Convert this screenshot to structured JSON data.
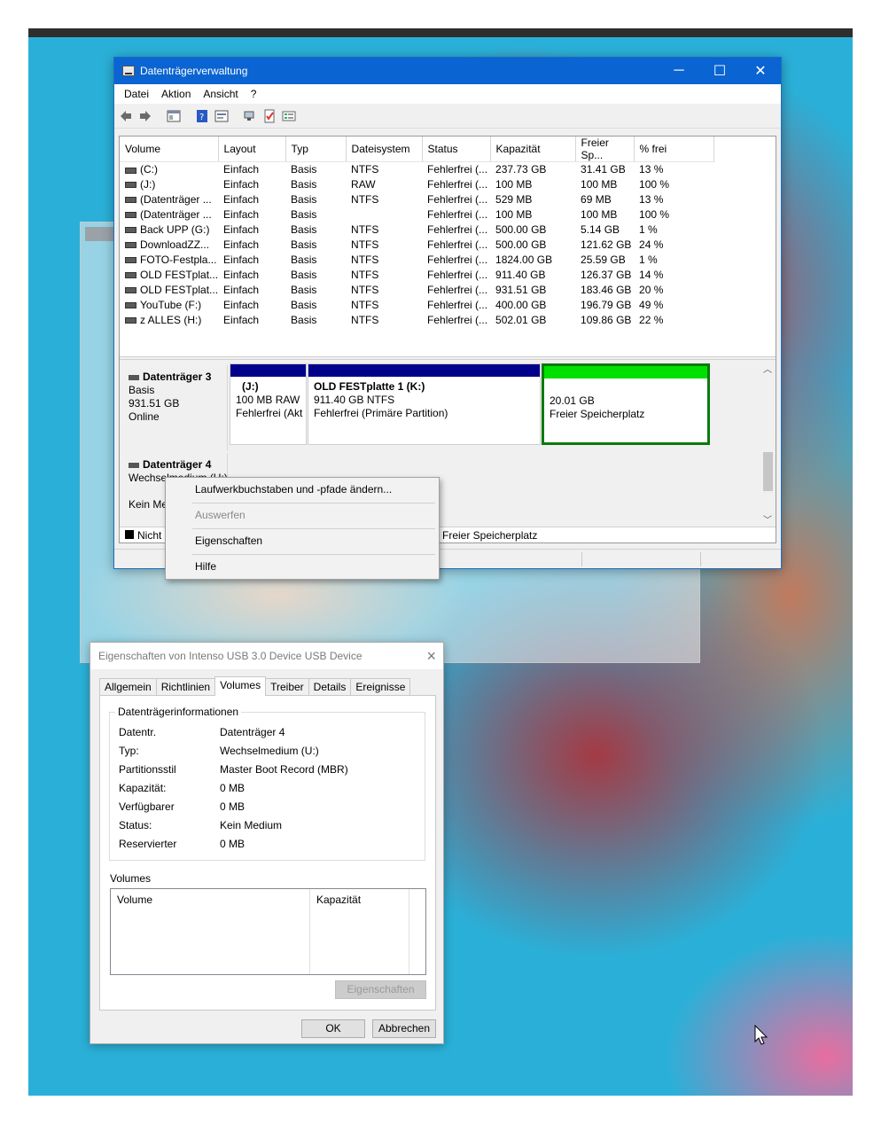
{
  "main_window": {
    "title": "Datenträgerverwaltung",
    "controls": {
      "minimize": "─",
      "maximize": "☐",
      "close": "✕"
    },
    "menu": [
      "Datei",
      "Aktion",
      "Ansicht",
      "?"
    ],
    "columns": [
      "Volume",
      "Layout",
      "Typ",
      "Dateisystem",
      "Status",
      "Kapazität",
      "Freier Sp...",
      "% frei"
    ],
    "volumes": [
      [
        "(C:)",
        "Einfach",
        "Basis",
        "NTFS",
        "Fehlerfrei (...",
        "237.73 GB",
        "31.41 GB",
        "13 %"
      ],
      [
        "(J:)",
        "Einfach",
        "Basis",
        "RAW",
        "Fehlerfrei (...",
        "100 MB",
        "100 MB",
        "100 %"
      ],
      [
        "(Datenträger ...",
        "Einfach",
        "Basis",
        "NTFS",
        "Fehlerfrei (...",
        "529 MB",
        "69 MB",
        "13 %"
      ],
      [
        "(Datenträger ...",
        "Einfach",
        "Basis",
        "",
        "Fehlerfrei (...",
        "100 MB",
        "100 MB",
        "100 %"
      ],
      [
        "Back UPP (G:)",
        "Einfach",
        "Basis",
        "NTFS",
        "Fehlerfrei (...",
        "500.00 GB",
        "5.14 GB",
        "1 %"
      ],
      [
        "DownloadZZ...",
        "Einfach",
        "Basis",
        "NTFS",
        "Fehlerfrei (...",
        "500.00 GB",
        "121.62 GB",
        "24 %"
      ],
      [
        "FOTO-Festpla...",
        "Einfach",
        "Basis",
        "NTFS",
        "Fehlerfrei (...",
        "1824.00 GB",
        "25.59 GB",
        "1 %"
      ],
      [
        "OLD FESTplat...",
        "Einfach",
        "Basis",
        "NTFS",
        "Fehlerfrei (...",
        "911.40 GB",
        "126.37 GB",
        "14 %"
      ],
      [
        "OLD FESTplat...",
        "Einfach",
        "Basis",
        "NTFS",
        "Fehlerfrei (...",
        "931.51 GB",
        "183.46 GB",
        "20 %"
      ],
      [
        "YouTube (F:)",
        "Einfach",
        "Basis",
        "NTFS",
        "Fehlerfrei (...",
        "400.00 GB",
        "196.79 GB",
        "49 %"
      ],
      [
        "z ALLES (H:)",
        "Einfach",
        "Basis",
        "NTFS",
        "Fehlerfrei (...",
        "502.01 GB",
        "109.86 GB",
        "22 %"
      ]
    ],
    "disk3": {
      "name": "Datenträger 3",
      "type": "Basis",
      "size": "931.51 GB",
      "state": "Online",
      "partitions": [
        {
          "name": "(J:)",
          "size": "100 MB RAW",
          "status": "Fehlerfrei (Akt"
        },
        {
          "name": "OLD FESTplatte 1  (K:)",
          "size": "911.40 GB NTFS",
          "status": "Fehlerfrei (Primäre Partition)"
        },
        {
          "name": "",
          "size": "20.01 GB",
          "status": "Freier Speicherplatz"
        }
      ]
    },
    "disk4": {
      "name": "Datenträger 4",
      "type": "Wechselmedium (U:)",
      "state": "Kein Me"
    },
    "legend": {
      "unallocated": "Nicht",
      "free": "Freier Speicherplatz"
    }
  },
  "context_menu": {
    "items": [
      "Laufwerkbuchstaben und -pfade ändern...",
      "Auswerfen",
      "Eigenschaften",
      "Hilfe"
    ]
  },
  "properties_dialog": {
    "title": "Eigenschaften von Intenso USB 3.0 Device USB Device",
    "tabs": [
      "Allgemein",
      "Richtlinien",
      "Volumes",
      "Treiber",
      "Details",
      "Ereignisse"
    ],
    "active_tab": "Volumes",
    "group_caption": "Datenträgerinformationen",
    "rows": [
      {
        "k": "Datentr.",
        "v": "Datenträger 4"
      },
      {
        "k": "Typ:",
        "v": "Wechselmedium (U:)"
      },
      {
        "k": "Partitionsstil",
        "v": "Master Boot Record (MBR)"
      },
      {
        "k": "Kapazität:",
        "v": "0 MB"
      },
      {
        "k": "Verfügbarer",
        "v": "0 MB"
      },
      {
        "k": "Status:",
        "v": "Kein Medium"
      },
      {
        "k": "Reservierter",
        "v": "0 MB"
      }
    ],
    "volumes_caption": "Volumes",
    "volumes_columns": [
      "Volume",
      "Kapazität"
    ],
    "props_button": "Eigenschaften",
    "ok": "OK",
    "cancel": "Abbrechen"
  },
  "colors": {
    "titlebar": "#0a64d2",
    "primary_partition": "#00008b",
    "free_space": "#00e000"
  }
}
